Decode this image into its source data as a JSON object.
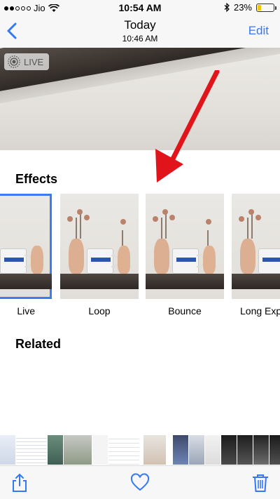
{
  "status_bar": {
    "carrier": "Jio",
    "time": "10:54 AM",
    "battery": "23%",
    "battery_level": 0.23
  },
  "nav": {
    "title": "Today",
    "subtitle": "10:46 AM",
    "edit_label": "Edit"
  },
  "photo": {
    "live_badge": "LIVE"
  },
  "effects": {
    "title": "Effects",
    "items": [
      {
        "label": "Live",
        "selected": true
      },
      {
        "label": "Loop",
        "selected": false
      },
      {
        "label": "Bounce",
        "selected": false
      },
      {
        "label": "Long Expo",
        "selected": false
      }
    ]
  },
  "related": {
    "title": "Related"
  },
  "colors": {
    "accent": "#3478f6",
    "selection": "#3d7cf0",
    "annotation_arrow": "#e2141b",
    "battery": "#f0c800"
  }
}
